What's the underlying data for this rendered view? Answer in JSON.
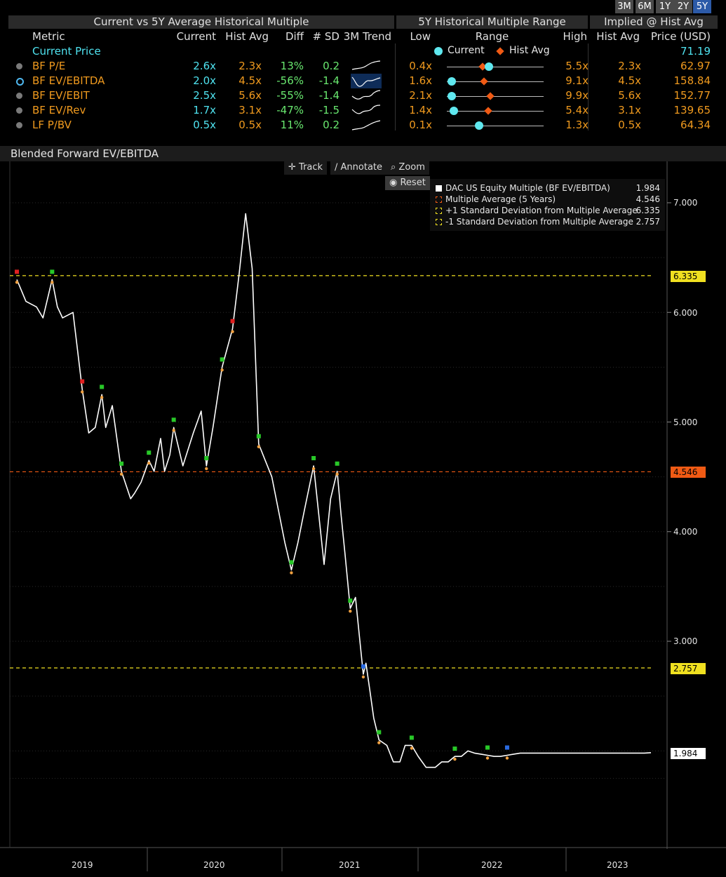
{
  "period_buttons": [
    "3M",
    "6M",
    "1Y",
    "2Y",
    "5Y"
  ],
  "active_period": "5Y",
  "groups": {
    "left": "Current vs 5Y Average Historical Multiple",
    "mid": "5Y Historical Multiple Range",
    "right": "Implied @ Hist Avg"
  },
  "columns": {
    "metric": "Metric",
    "current": "Current",
    "hist_avg": "Hist Avg",
    "diff": "Diff",
    "sd": "# SD",
    "trend": "3M Trend",
    "low": "Low",
    "range": "Range",
    "high": "High",
    "impl_hist_avg": "Hist Avg",
    "price": "Price (USD)"
  },
  "current_price": {
    "label": "Current Price",
    "value": "71.19"
  },
  "range_legend": {
    "current": "Current",
    "hist_avg": "Hist Avg"
  },
  "rows": [
    {
      "metric": "BF P/E",
      "current": "2.6x",
      "hist_avg": "2.3x",
      "diff": "13%",
      "sd": "0.2",
      "low": "0.4x",
      "high": "5.5x",
      "impl": "2.3x",
      "price": "62.97",
      "cur_num": 2.6,
      "avg_num": 2.3,
      "low_num": 0.4,
      "high_num": 5.5,
      "selected": false
    },
    {
      "metric": "BF EV/EBITDA",
      "current": "2.0x",
      "hist_avg": "4.5x",
      "diff": "-56%",
      "sd": "-1.4",
      "low": "1.6x",
      "high": "9.1x",
      "impl": "4.5x",
      "price": "158.84",
      "cur_num": 2.0,
      "avg_num": 4.5,
      "low_num": 1.6,
      "high_num": 9.1,
      "selected": true
    },
    {
      "metric": "BF EV/EBIT",
      "current": "2.5x",
      "hist_avg": "5.6x",
      "diff": "-55%",
      "sd": "-1.4",
      "low": "2.1x",
      "high": "9.9x",
      "impl": "5.6x",
      "price": "152.77",
      "cur_num": 2.5,
      "avg_num": 5.6,
      "low_num": 2.1,
      "high_num": 9.9,
      "selected": false
    },
    {
      "metric": "BF EV/Rev",
      "current": "1.7x",
      "hist_avg": "3.1x",
      "diff": "-47%",
      "sd": "-1.5",
      "low": "1.4x",
      "high": "5.4x",
      "impl": "3.1x",
      "price": "139.65",
      "cur_num": 1.7,
      "avg_num": 3.1,
      "low_num": 1.4,
      "high_num": 5.4,
      "selected": false
    },
    {
      "metric": "LF P/BV",
      "current": "0.5x",
      "hist_avg": "0.5x",
      "diff": "11%",
      "sd": "0.2",
      "low": "0.1x",
      "high": "1.3x",
      "impl": "0.5x",
      "price": "64.34",
      "cur_num": 0.5,
      "avg_num": 0.5,
      "low_num": 0.1,
      "high_num": 1.3,
      "selected": false
    }
  ],
  "chart": {
    "title": "Blended Forward EV/EBITDA",
    "tools": {
      "track": "Track",
      "annotate": "Annotate",
      "zoom": "Zoom",
      "reset": "Reset"
    },
    "legend": [
      {
        "label": "DAC US Equity Multiple (BF EV/EBITDA)",
        "value": "1.984",
        "color": "#ffffff"
      },
      {
        "label": "Multiple Average (5 Years)",
        "value": "4.546",
        "color": "#f05a14"
      },
      {
        "label": "+1 Standard Deviation from Multiple Average",
        "value": "6.335",
        "color": "#f0e020"
      },
      {
        "label": "-1 Standard Deviation from Multiple Average",
        "value": "2.757",
        "color": "#f0e020"
      }
    ],
    "tags": {
      "plus_sd": "6.335",
      "avg": "4.546",
      "minus_sd": "2.757",
      "last": "1.984"
    },
    "axis_ticks": [
      "7.000",
      "6.000",
      "5.000",
      "4.000",
      "3.000"
    ],
    "x_labels": [
      "2019",
      "2020",
      "2021",
      "2022",
      "2023"
    ]
  },
  "chart_data": {
    "type": "line",
    "title": "Blended Forward EV/EBITDA",
    "ylim": [
      1.5,
      7.4
    ],
    "y_ticks": [
      3,
      4,
      5,
      6,
      7
    ],
    "x_labels": [
      "2019",
      "2020",
      "2021",
      "2022",
      "2023"
    ],
    "reference_lines": [
      {
        "name": "+1 Standard Deviation from Multiple Average",
        "value": 6.335,
        "color": "#f0e020"
      },
      {
        "name": "Multiple Average (5 Years)",
        "value": 4.546,
        "color": "#f05a14"
      },
      {
        "name": "-1 Standard Deviation from Multiple Average",
        "value": 2.757,
        "color": "#f0e020"
      }
    ],
    "series": [
      {
        "name": "DAC US Equity Multiple (BF EV/EBITDA)",
        "x": [
          2018.35,
          2018.42,
          2018.5,
          2018.55,
          2018.62,
          2018.66,
          2018.7,
          2018.78,
          2018.85,
          2018.9,
          2018.95,
          2019.0,
          2019.03,
          2019.08,
          2019.15,
          2019.22,
          2019.25,
          2019.3,
          2019.36,
          2019.4,
          2019.45,
          2019.48,
          2019.52,
          2019.55,
          2019.62,
          2019.7,
          2019.76,
          2019.8,
          2019.85,
          2019.92,
          2020.0,
          2020.05,
          2020.1,
          2020.15,
          2020.2,
          2020.25,
          2020.3,
          2020.35,
          2020.4,
          2020.45,
          2020.5,
          2020.55,
          2020.62,
          2020.7,
          2020.75,
          2020.8,
          2020.83,
          2020.86,
          2020.9,
          2020.94,
          2020.97,
          2021.0,
          2021.02,
          2021.05,
          2021.08,
          2021.12,
          2021.18,
          2021.23,
          2021.28,
          2021.32,
          2021.37,
          2021.42,
          2021.48,
          2021.55,
          2021.6,
          2021.65,
          2021.7,
          2021.75,
          2021.8,
          2021.85,
          2021.9,
          2021.95,
          2022.0,
          2022.05,
          2022.1,
          2022.15,
          2022.2,
          2022.25,
          2022.3,
          2022.35,
          2022.4,
          2022.45,
          2022.5,
          2022.55,
          2022.6,
          2022.65,
          2022.7,
          2022.75,
          2022.8,
          2022.85,
          2022.9,
          2022.95,
          2023.0,
          2023.05,
          2023.1,
          2023.15,
          2023.2
        ],
        "y": [
          6.3,
          6.1,
          6.05,
          5.95,
          6.3,
          6.05,
          5.95,
          6.0,
          5.3,
          4.9,
          4.95,
          5.25,
          4.95,
          5.15,
          4.55,
          4.3,
          4.35,
          4.45,
          4.65,
          4.55,
          4.85,
          4.55,
          4.7,
          4.95,
          4.6,
          4.9,
          5.1,
          4.6,
          4.95,
          5.5,
          5.85,
          6.35,
          6.9,
          6.4,
          4.8,
          4.65,
          4.5,
          4.2,
          3.9,
          3.65,
          3.9,
          4.2,
          4.6,
          3.7,
          4.3,
          4.55,
          4.15,
          3.8,
          3.3,
          3.4,
          3.05,
          2.7,
          2.8,
          2.55,
          2.3,
          2.1,
          2.05,
          1.9,
          1.9,
          2.05,
          2.05,
          1.95,
          1.85,
          1.85,
          1.9,
          1.9,
          1.95,
          1.95,
          2.0,
          1.98,
          1.97,
          1.96,
          1.95,
          1.95,
          1.96,
          1.97,
          1.98,
          1.98,
          1.98,
          1.98,
          1.98,
          1.98,
          1.98,
          1.98,
          1.98,
          1.98,
          1.98,
          1.98,
          1.98,
          1.98,
          1.98,
          1.98,
          1.98,
          1.98,
          1.98,
          1.98,
          1.984
        ]
      }
    ]
  }
}
